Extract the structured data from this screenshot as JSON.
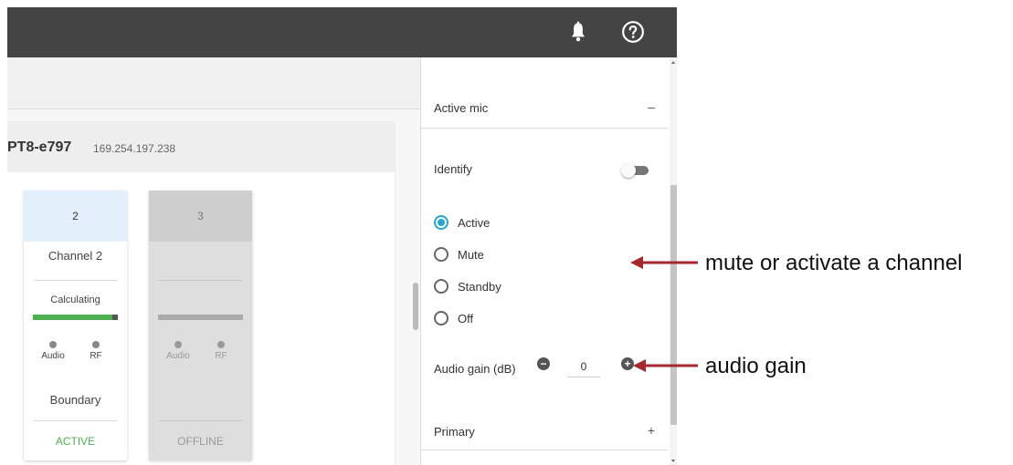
{
  "header": {
    "icons": [
      "bell-icon",
      "help-icon"
    ]
  },
  "device": {
    "name": "PT8-e797",
    "ip": "169.254.197.238"
  },
  "channels": [
    {
      "number": "2",
      "name": "Channel 2",
      "status": "Calculating",
      "meter_level": 0.95,
      "indicators": [
        "Audio",
        "RF"
      ],
      "mic_type": "Boundary",
      "state": "ACTIVE",
      "state_color": "#4caf50"
    },
    {
      "number": "3",
      "name": "",
      "status": "",
      "indicators": [
        "Audio",
        "RF"
      ],
      "mic_type": "",
      "state": "OFFLINE",
      "state_color": "#999999"
    }
  ],
  "panel": {
    "section_active_mic": "Active mic",
    "section_active_mic_sign": "–",
    "identify_label": "Identify",
    "identify_on": false,
    "radio_options": [
      "Active",
      "Mute",
      "Standby",
      "Off"
    ],
    "radio_selected": "Active",
    "audio_gain_label": "Audio gain (dB)",
    "audio_gain_value": "0",
    "section_primary": "Primary",
    "section_primary_sign": "+"
  },
  "annotations": {
    "mute_callout": "mute or activate a channel",
    "gain_callout": "audio gain",
    "arrow_color": "#a6282c"
  },
  "colors": {
    "topbar": "#444444",
    "accent": "#26a6d1",
    "active": "#4caf50"
  }
}
